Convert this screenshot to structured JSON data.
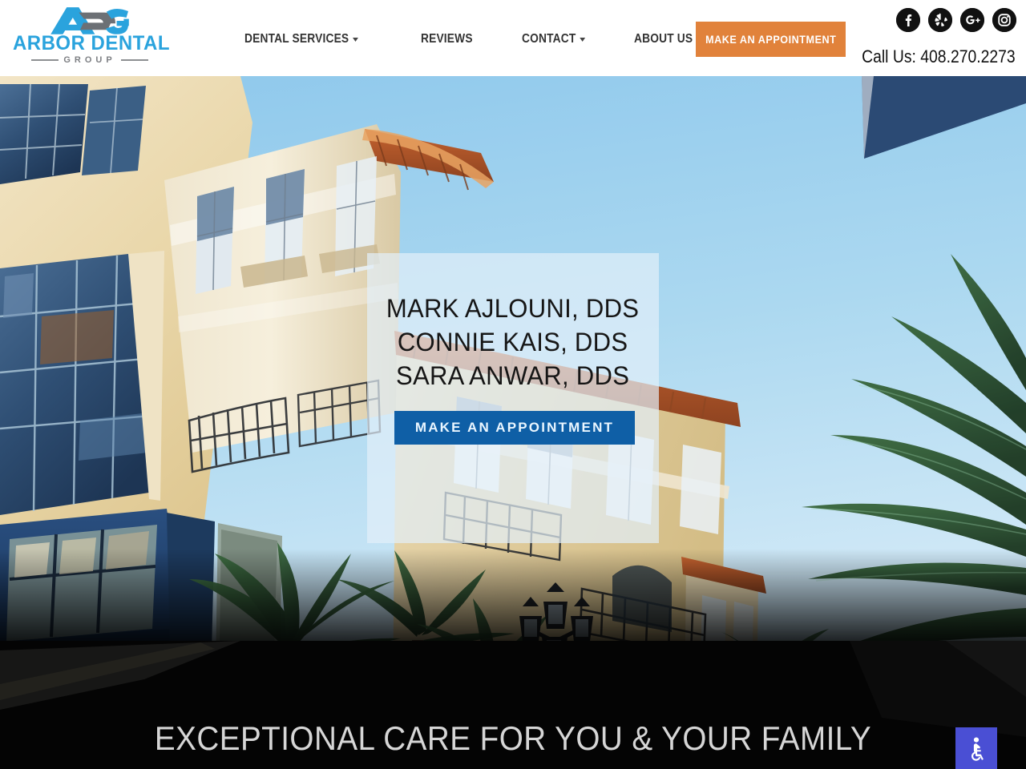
{
  "header": {
    "logo": {
      "mark_text": "ADG",
      "name": "ARBOR DENTAL",
      "subtitle": "GROUP",
      "brand_color": "#2aa3dd",
      "gray_color": "#7d7f83"
    },
    "nav": [
      {
        "label": "DENTAL SERVICES",
        "has_dropdown": true
      },
      {
        "label": "REVIEWS",
        "has_dropdown": false
      },
      {
        "label": "CONTACT",
        "has_dropdown": true
      },
      {
        "label": "ABOUT US",
        "has_dropdown": true
      }
    ],
    "appointment_button": {
      "label": "MAKE AN APPOINTMENT",
      "color": "#e1823b"
    },
    "socials": [
      {
        "name": "facebook-icon",
        "glyph": "f"
      },
      {
        "name": "yelp-icon",
        "glyph": "*"
      },
      {
        "name": "google-plus-icon",
        "glyph": "G+"
      },
      {
        "name": "instagram-icon",
        "glyph": "O"
      }
    ],
    "phone": "Call Us: 408.270.2273"
  },
  "hero": {
    "names": [
      "MARK AJLOUNI, DDS",
      "CONNIE KAIS, DDS",
      "SARA ANWAR, DDS"
    ],
    "cta": {
      "label": "MAKE AN APPOINTMENT",
      "color": "#0f5fa6"
    },
    "panel_color": "#e2f0fa"
  },
  "footer_banner": {
    "tagline": "EXCEPTIONAL CARE FOR YOU & YOUR FAMILY",
    "background": "#040404"
  },
  "accessibility_widget": {
    "name": "accessibility-button",
    "color": "#4a4fd4"
  }
}
